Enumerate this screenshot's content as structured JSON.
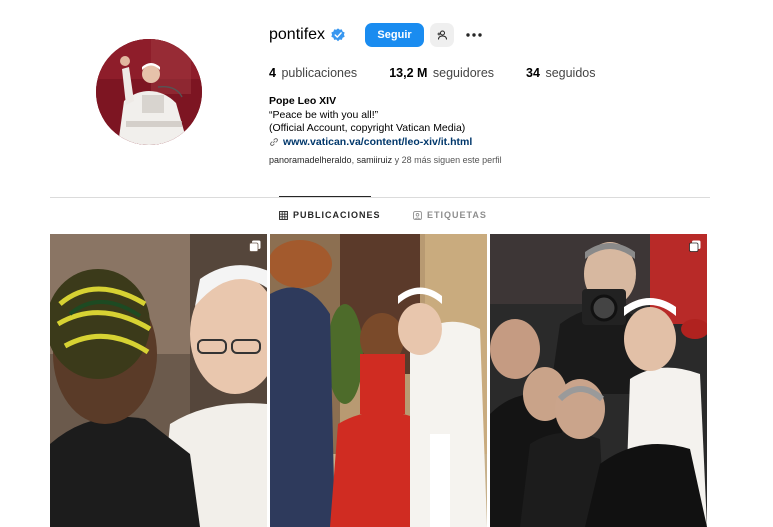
{
  "profile": {
    "username": "pontifex",
    "follow_label": "Seguir",
    "stats": [
      {
        "count": "4",
        "label": "publicaciones"
      },
      {
        "count": "13,2 M",
        "label": "seguidores"
      },
      {
        "count": "34",
        "label": "seguidos"
      }
    ],
    "bio": {
      "name": "Pope Leo XIV",
      "line1": "“Peace be with you all!”",
      "line2": "(Official Account, copyright Vatican Media)",
      "link": "www.vatican.va/content/leo-xiv/it.html"
    },
    "followed_by": {
      "user1": "panoramadelheraldo",
      "sep": ", ",
      "user2": "samiiruiz",
      "rest": " y 28 más siguen este perfil"
    }
  },
  "tabs": [
    {
      "label": "PUBLICACIONES",
      "active": true
    },
    {
      "label": "ETIQUETAS",
      "active": false
    }
  ],
  "colors": {
    "accent": "#1a8cf0",
    "link": "#00376b",
    "verified": "#3897f0"
  },
  "icons": [
    "verified-badge-icon",
    "add-person-icon",
    "more-options-icon",
    "link-icon",
    "grid-icon",
    "tagged-icon",
    "multiple-posts-icon"
  ]
}
